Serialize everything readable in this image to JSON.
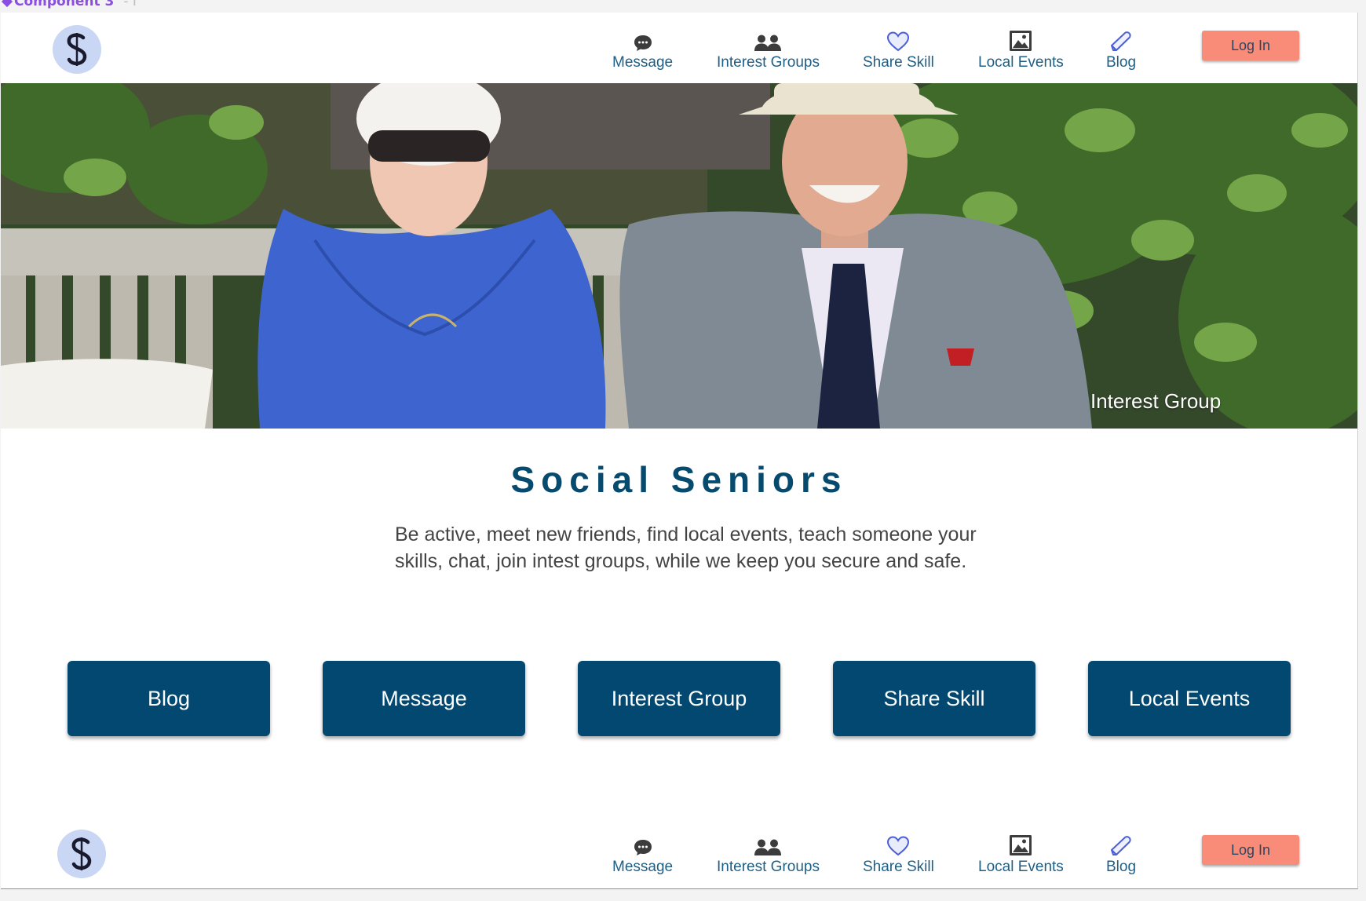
{
  "editor": {
    "frame_label": "Component 3",
    "frame_label_suffix": "- I"
  },
  "header": {
    "logo_letter": "S",
    "nav": [
      {
        "label": "Message",
        "icon": "chat-bubble-icon"
      },
      {
        "label": "Interest Groups",
        "icon": "people-icon"
      },
      {
        "label": "Share Skill",
        "icon": "heart-icon"
      },
      {
        "label": "Local Events",
        "icon": "image-icon"
      },
      {
        "label": "Blog",
        "icon": "pencil-icon"
      }
    ],
    "login_label": "Log In"
  },
  "hero": {
    "caption": "Interest Group"
  },
  "main": {
    "title": "Social Seniors",
    "tagline_line1": "Be active, meet new friends, find local events, teach someone your",
    "tagline_line2": "skills, chat, join intest groups, while we keep you secure and safe.",
    "buttons": [
      "Blog",
      "Message",
      "Interest Group",
      "Share Skill",
      "Local Events"
    ]
  },
  "footer": {
    "nav": [
      {
        "label": "Message",
        "icon": "chat-bubble-icon"
      },
      {
        "label": "Interest Groups",
        "icon": "people-icon"
      },
      {
        "label": "Share Skill",
        "icon": "heart-icon"
      },
      {
        "label": "Local Events",
        "icon": "image-icon"
      },
      {
        "label": "Blog",
        "icon": "pencil-icon"
      }
    ],
    "login_label": "Log In"
  },
  "colors": {
    "brand_navy": "#024870",
    "title_blue": "#064a6e",
    "nav_text": "#1f5f86",
    "login_salmon": "#f98c79",
    "logo_bg": "#c9d6f4",
    "editor_purple": "#8a4fe0"
  }
}
